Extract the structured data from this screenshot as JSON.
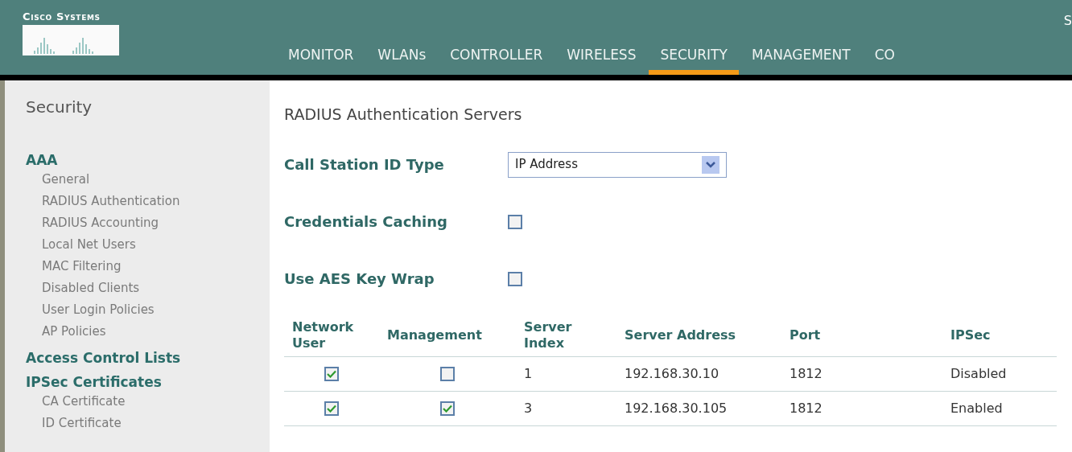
{
  "header": {
    "brand": "Cisco Systems",
    "corner_text": "S",
    "tabs": [
      {
        "label": "MONITOR",
        "selected": false
      },
      {
        "label": "WLANs",
        "selected": false
      },
      {
        "label": "CONTROLLER",
        "selected": false
      },
      {
        "label": "WIRELESS",
        "selected": false
      },
      {
        "label": "SECURITY",
        "selected": true
      },
      {
        "label": "MANAGEMENT",
        "selected": false
      },
      {
        "label": "CO",
        "selected": false
      }
    ]
  },
  "sidebar": {
    "title": "Security",
    "sections": [
      {
        "label": "AAA",
        "items": [
          "General",
          "RADIUS Authentication",
          "RADIUS Accounting",
          "Local Net Users",
          "MAC Filtering",
          "Disabled Clients",
          "User Login Policies",
          "AP Policies"
        ]
      },
      {
        "label": "Access Control Lists"
      },
      {
        "label": "IPSec Certificates",
        "items": [
          "CA Certificate",
          "ID Certificate"
        ]
      }
    ]
  },
  "main": {
    "title": "RADIUS Authentication Servers",
    "fields": [
      {
        "kind": "select",
        "label": "Call Station ID Type",
        "value": "IP Address"
      },
      {
        "kind": "checkbox",
        "label": "Credentials Caching",
        "checked": false
      },
      {
        "kind": "checkbox",
        "label": "Use AES Key Wrap",
        "checked": false
      }
    ],
    "table": {
      "columns": [
        "Network User",
        "Management",
        "Server Index",
        "Server Address",
        "Port",
        "IPSec"
      ],
      "rows": [
        {
          "network_user": true,
          "management": false,
          "server_index": "1",
          "server_address": "192.168.30.10",
          "port": "1812",
          "ipsec": "Disabled"
        },
        {
          "network_user": true,
          "management": true,
          "server_index": "3",
          "server_address": "192.168.30.105",
          "port": "1812",
          "ipsec": "Enabled"
        }
      ]
    }
  }
}
